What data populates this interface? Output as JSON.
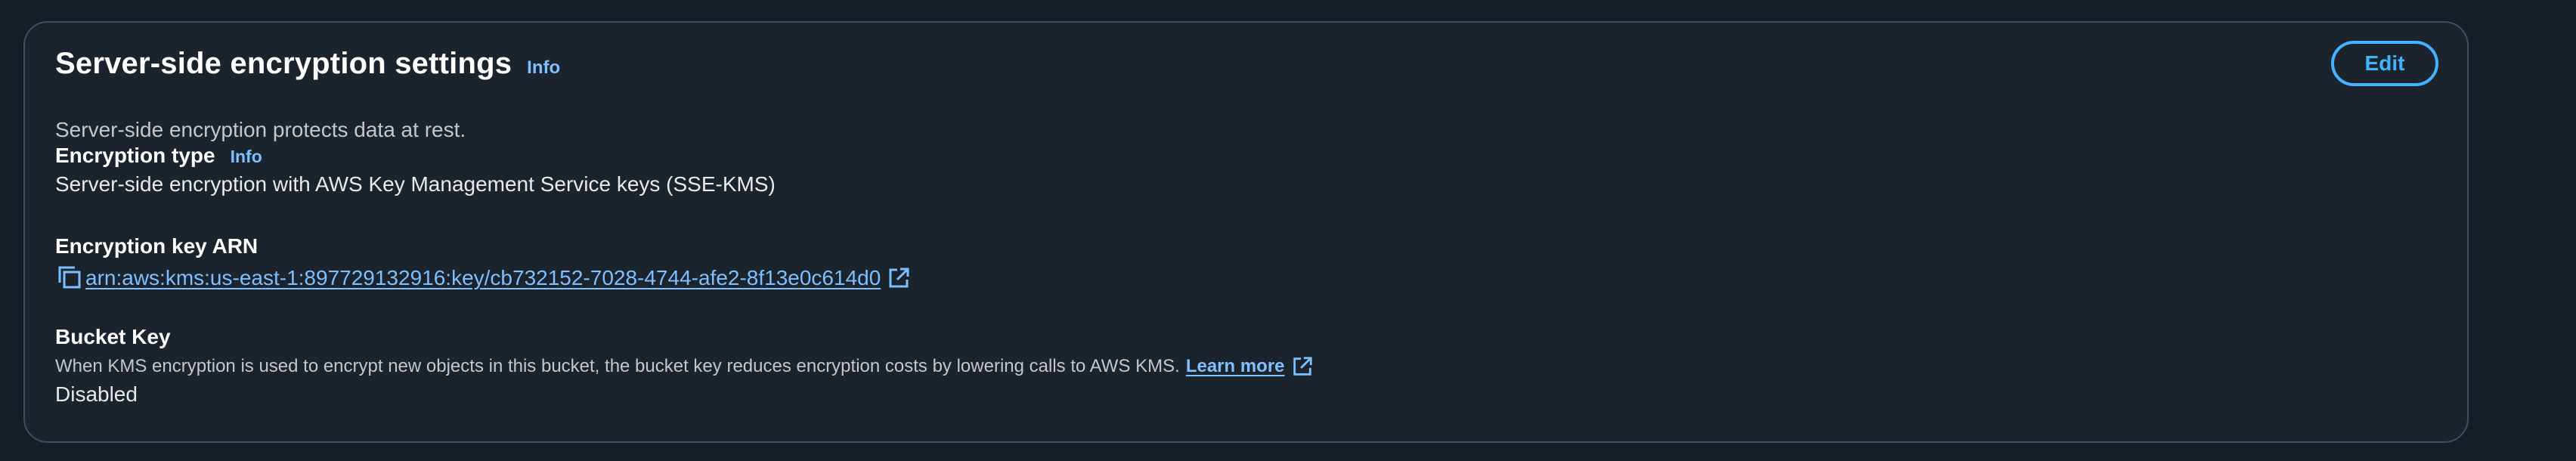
{
  "panel": {
    "title": "Server-side encryption settings",
    "info_label": "Info",
    "description": "Server-side encryption protects data at rest.",
    "edit_label": "Edit"
  },
  "encryption_type": {
    "label": "Encryption type",
    "info_label": "Info",
    "value": "Server-side encryption with AWS Key Management Service keys (SSE-KMS)"
  },
  "encryption_key": {
    "label": "Encryption key ARN",
    "arn": "arn:aws:kms:us-east-1:897729132916:key/cb732152-7028-4744-afe2-8f13e0c614d0",
    "copy_icon": "copy-icon",
    "external_icon": "external-link-icon"
  },
  "bucket_key": {
    "label": "Bucket Key",
    "hint": "When KMS encryption is used to encrypt new objects in this bucket, the bucket key reduces encryption costs by lowering calls to AWS KMS.",
    "learn_more": "Learn more",
    "value": "Disabled",
    "external_icon": "external-link-icon"
  },
  "colors": {
    "background": "#161d26",
    "panel": "#1b232d",
    "border": "#414d5c",
    "link": "#7cc0ff",
    "button": "#42b4ff"
  }
}
